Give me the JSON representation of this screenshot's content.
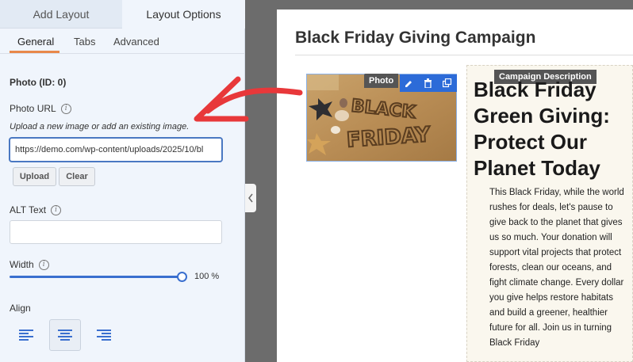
{
  "panel": {
    "top_tabs": [
      "Add Layout",
      "Layout Options"
    ],
    "sub_tabs": [
      "General",
      "Tabs",
      "Advanced"
    ],
    "section_title": "Photo (ID: 0)",
    "photo_url": {
      "label": "Photo URL",
      "help": "Upload a new image or add an existing image.",
      "value": "https://demo.com/wp-content/uploads/2025/10/bl"
    },
    "buttons": {
      "upload": "Upload",
      "clear": "Clear"
    },
    "alt_text": {
      "label": "ALT Text",
      "value": ""
    },
    "width": {
      "label": "Width",
      "value": "100",
      "unit": "%",
      "level": 1.0
    },
    "align": {
      "label": "Align",
      "selected": "center"
    }
  },
  "canvas": {
    "page_title": "Black Friday Giving Campaign",
    "photo_badge": "Photo",
    "desc_badge": "Campaign Description",
    "heading": "Black Friday Green Giving: Protect Our Planet Today",
    "body": "This Black Friday, while the world rushes for deals, let's pause to give back to the planet that gives us so much. Your donation will support vital projects that protect forests, clean our oceans, and fight climate change. Every dollar you give helps restore habitats and build a greener, healthier future for all. Join us in turning Black Friday",
    "image_text": "BLACK FRIDAY"
  },
  "colors": {
    "accent": "#2c6bd8",
    "tab_underline": "#e8884a",
    "arrow": "#e8383a"
  }
}
